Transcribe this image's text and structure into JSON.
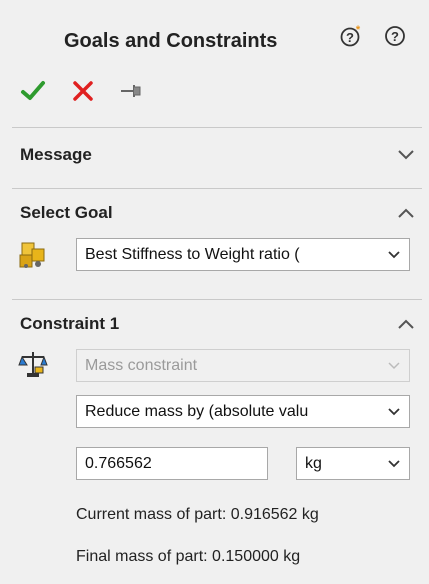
{
  "header": {
    "title": "Goals and Constraints"
  },
  "sections": {
    "message": {
      "title": "Message"
    },
    "select_goal": {
      "title": "Select Goal",
      "goal_value": "Best Stiffness to Weight ratio ("
    },
    "constraint1": {
      "title": "Constraint 1",
      "constraint_type": "Mass constraint",
      "reduce_mode": "Reduce mass by (absolute valu",
      "amount": "0.766562",
      "unit": "kg",
      "current_mass": "Current mass of part: 0.916562 kg",
      "final_mass": "Final mass of part: 0.150000 kg"
    }
  },
  "colors": {
    "ok": "#2e9b2e",
    "cancel": "#e02020",
    "accent_yellow": "#e8b41a"
  }
}
